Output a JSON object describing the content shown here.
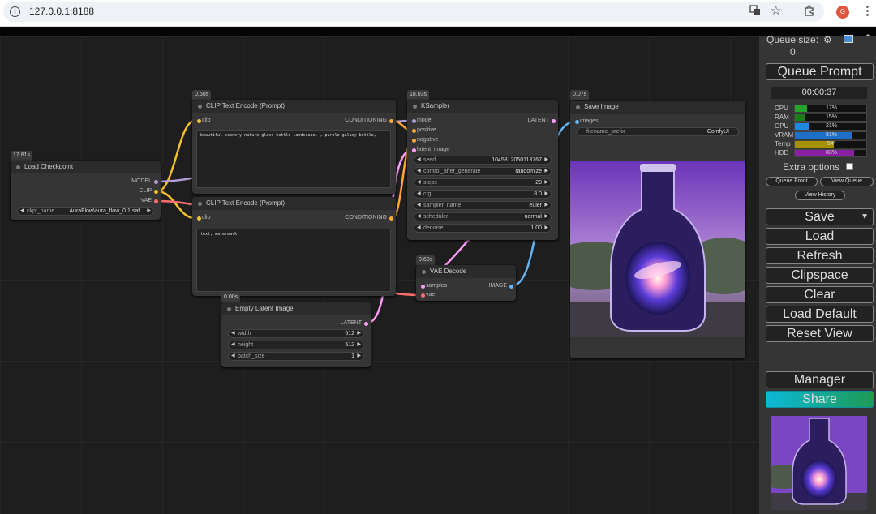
{
  "browser": {
    "url": "127.0.0.1:8188",
    "avatar": "G",
    "icons": [
      "info-icon",
      "translate-icon",
      "star-icon",
      "extensions-icon",
      "profile-avatar",
      "more-icon"
    ]
  },
  "nodes": {
    "load_checkpoint": {
      "timing": "17.81s",
      "title": "Load Checkpoint",
      "outputs": [
        "MODEL",
        "CLIP",
        "VAE"
      ],
      "ckpt_label": "ckpt_name",
      "ckpt_value": "AuraFlow\\aura_flow_0.1.saf..."
    },
    "clip_pos": {
      "timing": "0.60s",
      "title": "CLIP Text Encode (Prompt)",
      "input": "clip",
      "output": "CONDITIONING",
      "text": "beautiful scenery nature glass bottle landscape, , purple galaxy bottle,"
    },
    "clip_neg": {
      "timing": "",
      "title": "CLIP Text Encode (Prompt)",
      "input": "clip",
      "output": "CONDITIONING",
      "text": "text, watermark"
    },
    "ksampler": {
      "timing": "18.03s",
      "title": "KSampler",
      "inputs": [
        "model",
        "positive",
        "negative",
        "latent_image"
      ],
      "output": "LATENT",
      "widgets": [
        {
          "label": "seed",
          "value": "1045812050113767"
        },
        {
          "label": "control_after_generate",
          "value": "randomize"
        },
        {
          "label": "steps",
          "value": "20"
        },
        {
          "label": "cfg",
          "value": "8.0"
        },
        {
          "label": "sampler_name",
          "value": "euler"
        },
        {
          "label": "scheduler",
          "value": "normal"
        },
        {
          "label": "denoise",
          "value": "1.00"
        }
      ]
    },
    "save_image": {
      "timing": "0.07s",
      "title": "Save Image",
      "input": "images",
      "prefix_label": "filename_prefix",
      "prefix_value": "ComfyUI"
    },
    "vae_decode": {
      "timing": "0.60s",
      "title": "VAE Decode",
      "inputs": [
        "samples",
        "vae"
      ],
      "output": "IMAGE"
    },
    "empty_latent": {
      "timing": "0.00s",
      "title": "Empty Latent Image",
      "output": "LATENT",
      "widgets": [
        {
          "label": "width",
          "value": "512"
        },
        {
          "label": "height",
          "value": "512"
        },
        {
          "label": "batch_size",
          "value": "1"
        }
      ]
    }
  },
  "panel": {
    "queue_size_label": "Queue size:",
    "queue_size": "0",
    "queue_prompt": "Queue Prompt",
    "timer": "00:00:37",
    "stats": [
      {
        "label": "CPU",
        "value": "17%",
        "fill": 0.17,
        "color": "#22a52a"
      },
      {
        "label": "RAM",
        "value": "15%",
        "fill": 0.15,
        "color": "#1d7d1d"
      },
      {
        "label": "GPU",
        "value": "21%",
        "fill": 0.21,
        "color": "#1e88e5"
      },
      {
        "label": "VRAM",
        "value": "81%",
        "fill": 0.81,
        "color": "#1e6fc9"
      },
      {
        "label": "Temp",
        "value": "54°",
        "fill": 0.54,
        "color": "#a59100"
      },
      {
        "label": "HDD",
        "value": "83%",
        "fill": 0.83,
        "color": "#8a1fa3"
      }
    ],
    "extra_options": "Extra options",
    "queue_front": "Queue Front",
    "view_queue": "View Queue",
    "view_history": "View History",
    "buttons": [
      "Save",
      "Load",
      "Refresh",
      "Clipspace",
      "Clear",
      "Load Default",
      "Reset View"
    ],
    "save_dropdown": "▼",
    "manager": "Manager",
    "share": "Share"
  }
}
